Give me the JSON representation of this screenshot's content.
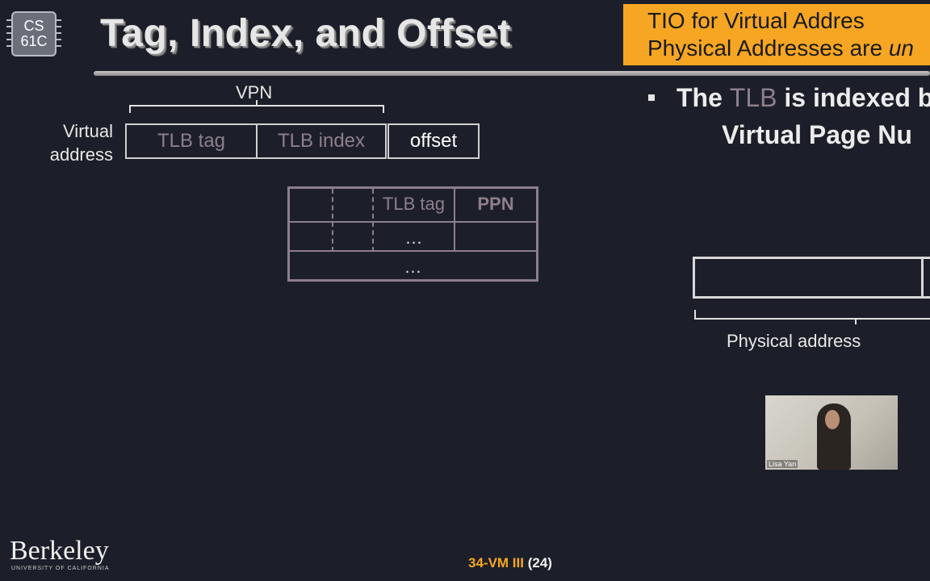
{
  "logo": {
    "line1": "CS",
    "line2": "61C"
  },
  "title": "Tag, Index, and Offset",
  "callout": {
    "line1": "TIO for Virtual Addres",
    "line2_pre": "Physical Addresses are ",
    "line2_em": "un"
  },
  "diagram": {
    "vpn_label": "VPN",
    "virtual_address_label_1": "Virtual",
    "virtual_address_label_2": "address",
    "fields": {
      "tag": "TLB tag",
      "index": "TLB index",
      "offset": "offset"
    },
    "tlb_table": {
      "col_tag": "TLB tag",
      "col_ppn": "PPN",
      "ellipsis": "…"
    }
  },
  "bullet": {
    "pre": "The ",
    "highlight": "TLB",
    "post": " is indexed b",
    "line2": "Virtual Page Nu"
  },
  "physical_address_label": "Physical address",
  "video": {
    "name": "Lisa Yan"
  },
  "footer": {
    "lecture": "34-VM III",
    "slide": "(24)"
  },
  "branding": {
    "berkeley": "Berkeley",
    "sub": "UNIVERSITY OF CALIFORNIA"
  }
}
